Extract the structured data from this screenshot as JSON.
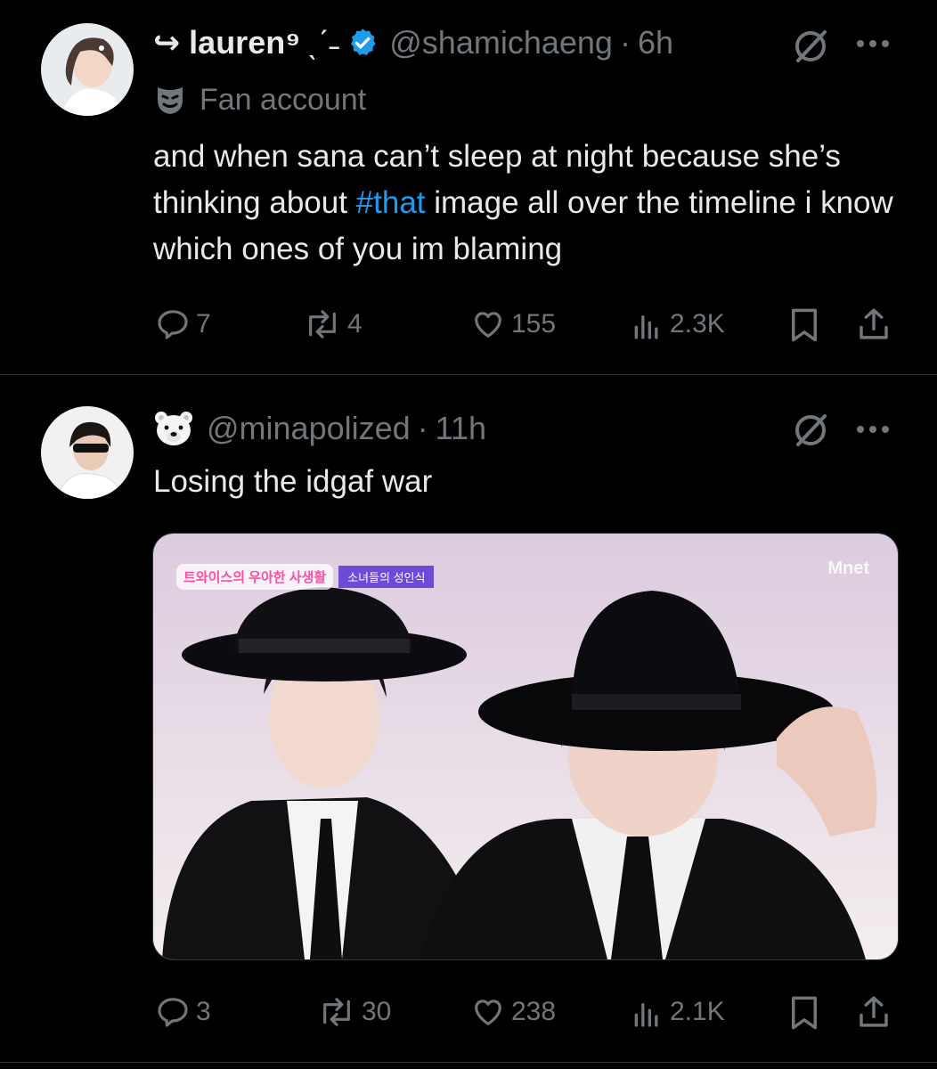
{
  "tweets": [
    {
      "retweet_prefix": "↪",
      "display_name": "lauren⁹",
      "name_emoticon": "ˎˊ˗",
      "handle": "@shamichaeng",
      "separator": "·",
      "time": "6h",
      "label": "Fan account",
      "text_before": "and when sana can’t sleep at night because she’s thinking about ",
      "hashtag": "#that",
      "text_after": " image all over the timeline i know which ones of you im blaming",
      "replies": "7",
      "retweets": "4",
      "likes": "155",
      "views": "2.3K"
    },
    {
      "name_emoji": "🐻‍❄️",
      "handle": "@minapolized",
      "separator": "·",
      "time": "11h",
      "text": "Losing the idgaf war",
      "media": {
        "show_logo": "트와이스의 우아한 사생활",
        "episode_banner": "소녀들의 성인식",
        "watermark": "Mnet"
      },
      "replies": "3",
      "retweets": "30",
      "likes": "238",
      "views": "2.1K"
    }
  ],
  "colors": {
    "background": "#000000",
    "text": "#e7e9ea",
    "muted": "#71767b",
    "accent": "#1d9bf0",
    "divider": "#2f3336"
  },
  "icons": [
    "reply-icon",
    "retweet-icon",
    "like-icon",
    "views-icon",
    "bookmark-icon",
    "share-icon",
    "grok-icon",
    "more-icon",
    "verified-badge-icon",
    "fan-account-icon"
  ]
}
